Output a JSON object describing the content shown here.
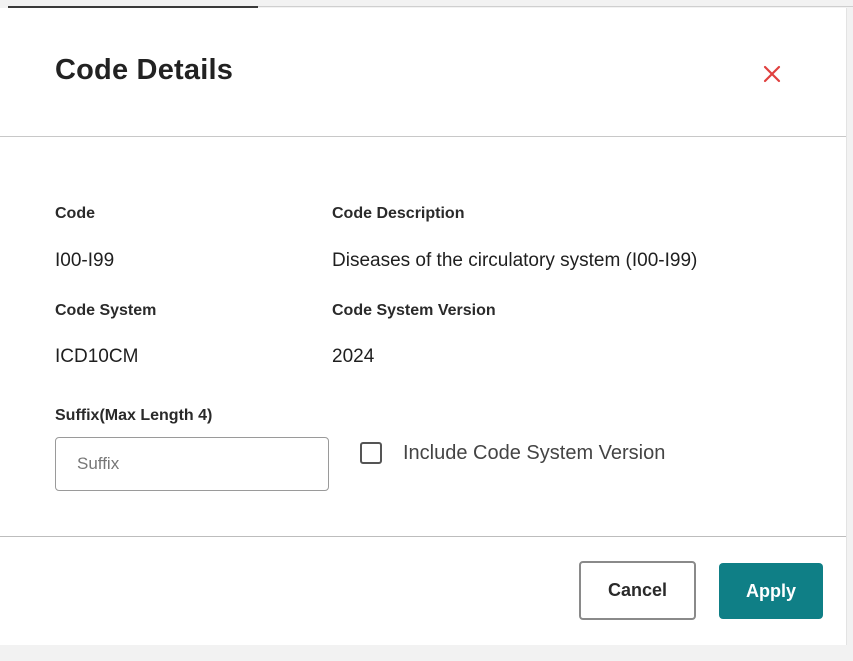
{
  "dialog": {
    "title": "Code Details",
    "close_icon": "close-icon",
    "close_color": "#e0403f"
  },
  "details": {
    "code_label": "Code",
    "code_value": "I00-I99",
    "description_label": "Code Description",
    "description_value": "Diseases of the circulatory system (I00-I99)",
    "system_label": "Code System",
    "system_value": "ICD10CM",
    "version_label": "Code System Version",
    "version_value": "2024"
  },
  "suffix": {
    "label": "Suffix(Max Length 4)",
    "placeholder": "Suffix",
    "value": ""
  },
  "include_version": {
    "label": "Include Code System Version",
    "checked": false
  },
  "footer": {
    "cancel_label": "Cancel",
    "apply_label": "Apply",
    "apply_color": "#0f7f86"
  }
}
